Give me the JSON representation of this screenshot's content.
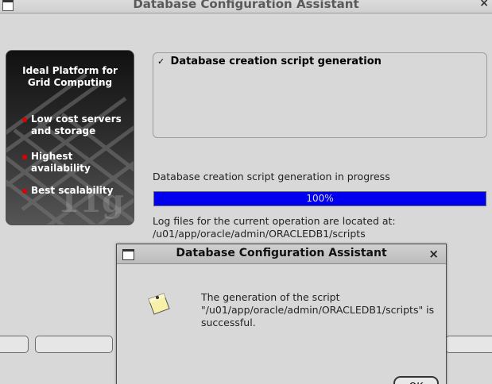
{
  "main_window": {
    "title": "Database Configuration Assistant",
    "close_glyph": "×"
  },
  "promo": {
    "heading_line1": "Ideal Platform for",
    "heading_line2": "Grid Computing",
    "bullets": [
      {
        "line1": "Low cost servers",
        "line2": "and storage"
      },
      {
        "line1": "Highest availability",
        "line2": ""
      },
      {
        "line1": "Best scalability",
        "line2": ""
      }
    ],
    "brand": "11g"
  },
  "steps": [
    {
      "check": "✓",
      "label": "Database creation script generation"
    }
  ],
  "progress": {
    "label": "Database creation script generation in progress",
    "fraction": 1.0,
    "text": "100%"
  },
  "log": {
    "line1": "Log files for the current operation are located at:",
    "line2": "/u01/app/oracle/admin/ORACLEDB1/scripts"
  },
  "dialog": {
    "title": "Database Configuration Assistant",
    "close_glyph": "×",
    "icon": "note-icon",
    "message_line1": "The generation of the script",
    "message_line2": "\"/u01/app/oracle/admin/ORACLEDB1/scripts\" is",
    "message_line3": "successful.",
    "ok_label": "OK"
  },
  "colors": {
    "progress_fill": "#0000ee",
    "bullet_dot": "#e00000",
    "window_bg": "#d8d8d8"
  }
}
